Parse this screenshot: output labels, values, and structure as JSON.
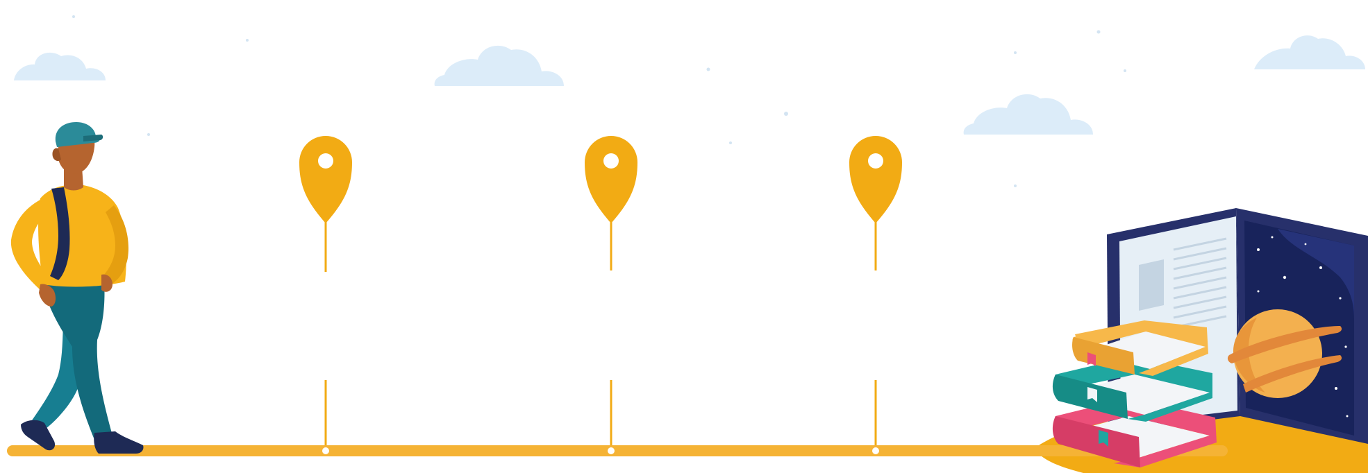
{
  "scene": {
    "type": "learning-journey-timeline",
    "milestone_count": 3,
    "colors": {
      "background": "#ffffff",
      "road": "#f5b335",
      "pin": "#f2ab14",
      "pin_hole": "#ffffff",
      "cloud": "#dcecf9",
      "sparkle": "#d3e4f2",
      "platform": "#f2ab14",
      "person_skin": "#b5642f",
      "person_cap": "#2b8b99",
      "person_shirt": "#f7b319",
      "person_pants": "#177e91",
      "person_backpack": "#1e2a55",
      "book_cover": "#27306b",
      "book_page": "#e6eff6",
      "book_space": "#18235b",
      "planet": "#f3b04f",
      "stack_book_yellow": "#f7b84a",
      "stack_book_teal": "#1fa7a0",
      "stack_book_pink": "#ec4f79"
    },
    "icons": {
      "milestone": "map-pin-icon",
      "start": "walking-student",
      "end": "open-book-with-stack"
    }
  }
}
